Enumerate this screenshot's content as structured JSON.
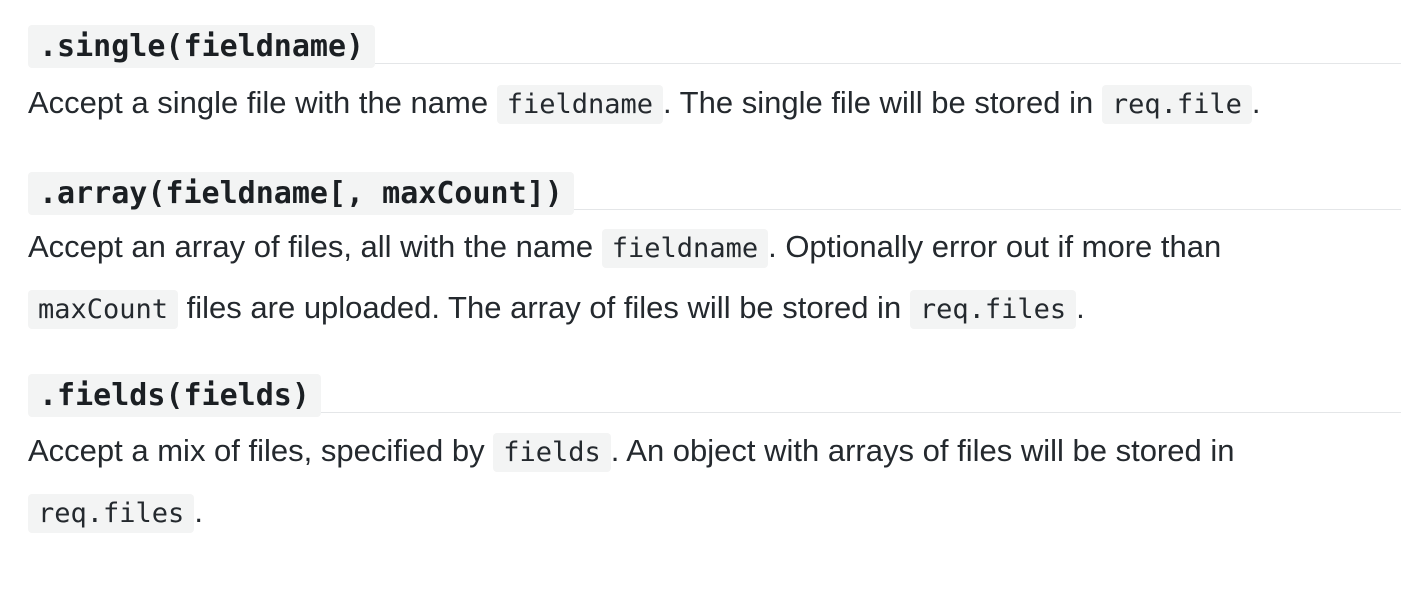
{
  "sections": [
    {
      "heading": ".single(fieldname)",
      "paragraph": {
        "t1": "Accept a single file with the name ",
        "c1": "fieldname",
        "t2": ". The single file will be stored in ",
        "c2": "req.file",
        "t3": "."
      }
    },
    {
      "heading": ".array(fieldname[, maxCount])",
      "paragraph": {
        "line1": {
          "t1": "Accept an array of files, all with the name ",
          "c1": "fieldname",
          "t2": ". Optionally error out if more than"
        },
        "line2": {
          "c1": "maxCount",
          "t1": " files are uploaded. The array of files will be stored in ",
          "c2": "req.files",
          "t2": "."
        }
      }
    },
    {
      "heading": ".fields(fields)",
      "paragraph": {
        "line1": {
          "t1": "Accept a mix of files, specified by ",
          "c1": "fields",
          "t2": ". An object with arrays of files will be stored in"
        },
        "line2": {
          "c1": "req.files",
          "t1": "."
        }
      }
    }
  ]
}
